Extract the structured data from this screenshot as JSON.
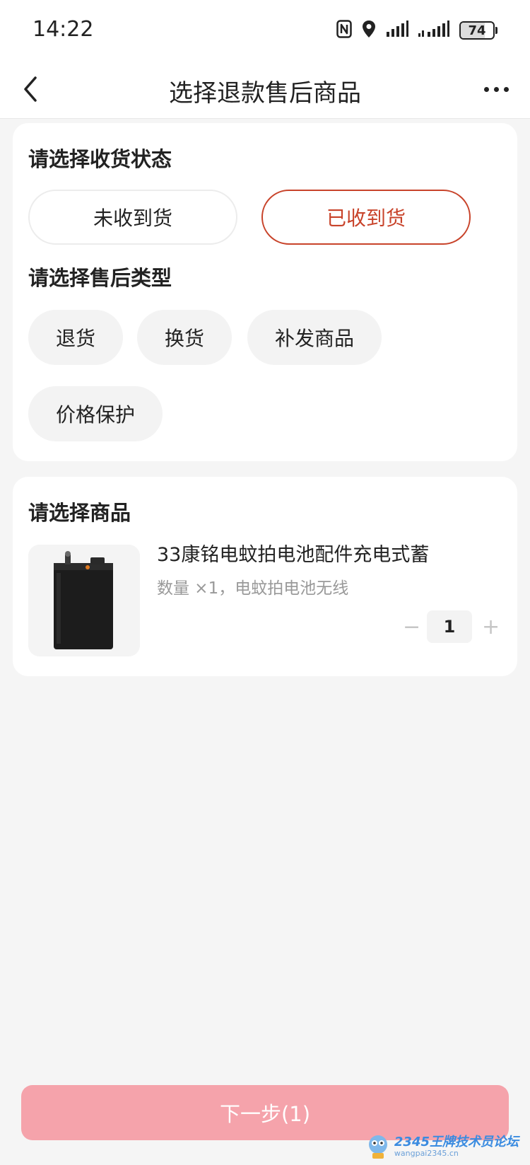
{
  "status_bar": {
    "time": "14:22",
    "battery": "74",
    "battery_level_percent": 74,
    "icons": [
      "nfc-icon",
      "location-icon",
      "signal-icon",
      "signal-icon"
    ]
  },
  "nav": {
    "title": "选择退款售后商品",
    "back_icon": "chevron-left-icon",
    "more_icon": "more-horizontal-icon"
  },
  "receipt_section": {
    "title": "请选择收货状态",
    "options": [
      {
        "label": "未收到货",
        "selected": false
      },
      {
        "label": "已收到货",
        "selected": true
      }
    ]
  },
  "type_section": {
    "title": "请选择售后类型",
    "options": [
      {
        "label": "退货"
      },
      {
        "label": "换货"
      },
      {
        "label": "补发商品"
      },
      {
        "label": "价格保护"
      }
    ]
  },
  "product_section": {
    "title": "请选择商品",
    "product": {
      "title": "33康铭电蚊拍电池配件充电式蓄",
      "spec": "数量 ×1，电蚊拍电池无线",
      "quantity": "1",
      "minus": "−",
      "plus": "+"
    }
  },
  "footer": {
    "next_label": "下一步(1)"
  },
  "watermark": {
    "brand": "2345王牌技术员论坛",
    "url": "wangpai2345.cn"
  },
  "colors": {
    "accent": "#c8432a",
    "next_button": "#f5a3ab",
    "background": "#f5f5f5"
  }
}
